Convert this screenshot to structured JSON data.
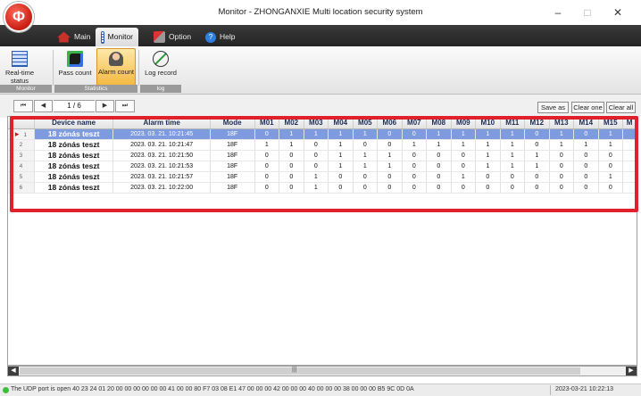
{
  "window": {
    "title": "Monitor - ZHONGANXIE Multi location security system",
    "logo_char": "Φ"
  },
  "window_controls": {
    "minimize": "–",
    "maximize": "□",
    "close": "✕"
  },
  "menu": [
    {
      "label": "Main",
      "icon": "home-icon"
    },
    {
      "label": "Monitor",
      "icon": "monitor-icon"
    },
    {
      "label": "Option",
      "icon": "wrench-icon"
    },
    {
      "label": "Help",
      "icon": "help-icon"
    }
  ],
  "ribbon": {
    "groups": [
      {
        "caption": "Monitor",
        "buttons": [
          {
            "label": "Real-time status",
            "icon": "realtime-status-icon"
          }
        ]
      },
      {
        "caption": "Statistics",
        "buttons": [
          {
            "label": "Pass count",
            "icon": "pass-count-icon"
          },
          {
            "label": "Alarm count",
            "icon": "alarm-count-icon",
            "active": true
          }
        ]
      },
      {
        "caption": "log",
        "buttons": [
          {
            "label": "Log record",
            "icon": "log-record-icon"
          }
        ]
      }
    ]
  },
  "pager": {
    "first": "⏮",
    "prev": "◀",
    "page_text": "1 / 6",
    "next": "▶",
    "last": "⏭"
  },
  "actions": {
    "save_as": "Save as",
    "clear_one": "Clear one",
    "clear_all": "Clear all"
  },
  "table": {
    "columns": [
      "",
      "Device name",
      "Alarm time",
      "Mode",
      "M01",
      "M02",
      "M03",
      "M04",
      "M05",
      "M06",
      "M07",
      "M08",
      "M09",
      "M10",
      "M11",
      "M12",
      "M13",
      "M14",
      "M15",
      "M"
    ],
    "selected_row_marker": "▸",
    "rows": [
      {
        "idx": "1",
        "device": "18 zónás teszt",
        "time": "2023. 03. 21. 10:21:45",
        "mode": "18F",
        "m": [
          "0",
          "1",
          "1",
          "1",
          "1",
          "0",
          "0",
          "1",
          "1",
          "1",
          "1",
          "0",
          "1",
          "0",
          "1"
        ]
      },
      {
        "idx": "2",
        "device": "18 zónás teszt",
        "time": "2023. 03. 21. 10:21:47",
        "mode": "18F",
        "m": [
          "1",
          "1",
          "0",
          "1",
          "0",
          "0",
          "1",
          "1",
          "1",
          "1",
          "1",
          "0",
          "1",
          "1",
          "1"
        ]
      },
      {
        "idx": "3",
        "device": "18 zónás teszt",
        "time": "2023. 03. 21. 10:21:50",
        "mode": "18F",
        "m": [
          "0",
          "0",
          "0",
          "1",
          "1",
          "1",
          "0",
          "0",
          "0",
          "1",
          "1",
          "1",
          "0",
          "0",
          "0"
        ]
      },
      {
        "idx": "4",
        "device": "18 zónás teszt",
        "time": "2023. 03. 21. 10:21:53",
        "mode": "18F",
        "m": [
          "0",
          "0",
          "0",
          "1",
          "1",
          "1",
          "0",
          "0",
          "0",
          "1",
          "1",
          "1",
          "0",
          "0",
          "0"
        ]
      },
      {
        "idx": "5",
        "device": "18 zónás teszt",
        "time": "2023. 03. 21. 10:21:57",
        "mode": "18F",
        "m": [
          "0",
          "0",
          "1",
          "0",
          "0",
          "0",
          "0",
          "0",
          "1",
          "0",
          "0",
          "0",
          "0",
          "0",
          "1"
        ]
      },
      {
        "idx": "6",
        "device": "18 zónás teszt",
        "time": "2023. 03. 21. 10:22:00",
        "mode": "18F",
        "m": [
          "0",
          "0",
          "1",
          "0",
          "0",
          "0",
          "0",
          "0",
          "0",
          "0",
          "0",
          "0",
          "0",
          "0",
          "0"
        ]
      }
    ]
  },
  "scrollbar": {
    "left": "◀",
    "right": "▶",
    "grip": "|||"
  },
  "status": {
    "message": "The UDP port is open  40 23 24 01 20 00 00 00 00 00 00 41 00 00 80 F7 03 08 E1 47 00 00 00 42 00 00 00 40 00 00 00 38 00 00 00 B5 9C 0D 0A",
    "time": "2023-03-21 10:22:13"
  },
  "colors": {
    "highlight": "#e0202a",
    "selected_row": "#7f9be0",
    "active_ribbon": "#f4b943",
    "menubar": "#2b2b2b"
  }
}
